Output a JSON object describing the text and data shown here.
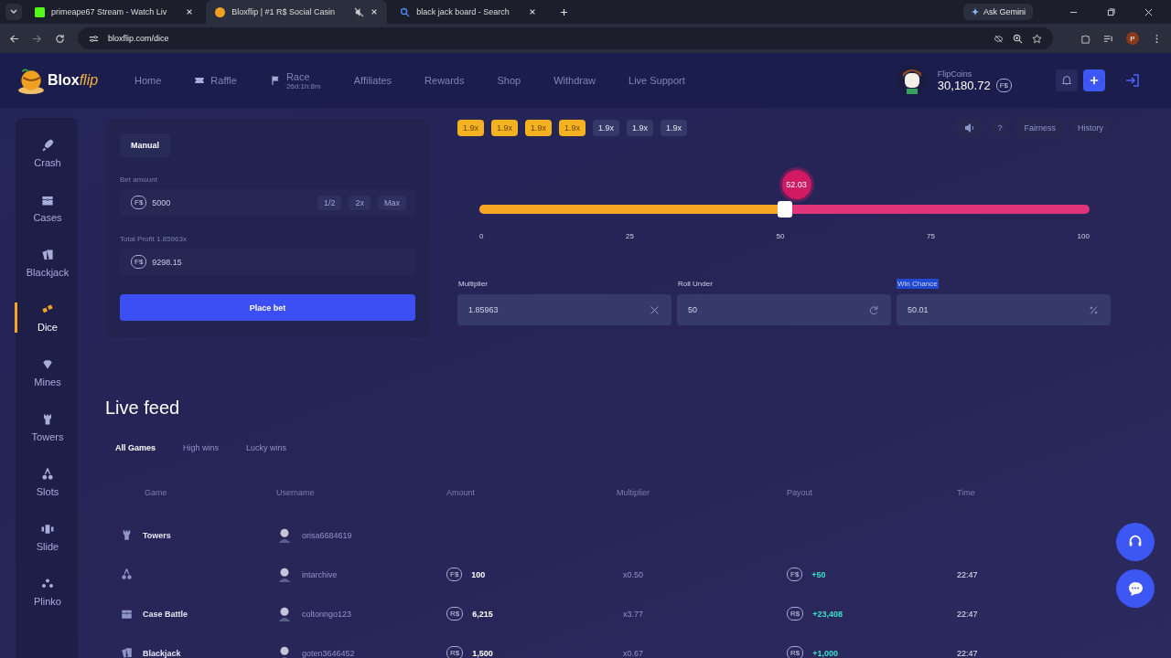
{
  "browser": {
    "tabs": [
      {
        "title": "primeape67 Stream - Watch Liv",
        "kind": "kick",
        "selected": false
      },
      {
        "title": "Bloxflip | #1 R$ Social Casin",
        "kind": "coin",
        "selected": true,
        "muted": true
      },
      {
        "title": "black jack board - Search",
        "kind": "search",
        "selected": false
      }
    ],
    "url": "bloxflip.com/dice",
    "gemini": "Ask Gemini",
    "profile": "P"
  },
  "header": {
    "logo": "Blox",
    "logo_accent": "flip",
    "nav": [
      {
        "label": "Home",
        "kind": "text"
      },
      {
        "label": "Raffle",
        "kind": "raffle"
      },
      {
        "label": "Race",
        "kind": "race",
        "sub": "26d:1h:8m"
      },
      {
        "label": "Affiliates",
        "kind": "text"
      },
      {
        "label": "Rewards",
        "kind": "text"
      },
      {
        "label": "Shop",
        "kind": "text"
      },
      {
        "label": "Withdraw",
        "kind": "text"
      },
      {
        "label": "Live Support",
        "kind": "text"
      }
    ],
    "balance": {
      "label": "FlipCoins",
      "amount": "30,180.72",
      "currency": "F$"
    }
  },
  "sidebar": {
    "items": [
      {
        "label": "Crash",
        "kind": "crash",
        "selected": false
      },
      {
        "label": "Cases",
        "kind": "cases",
        "selected": false
      },
      {
        "label": "Blackjack",
        "kind": "blackjack",
        "selected": false
      },
      {
        "label": "Dice",
        "kind": "dice",
        "selected": true
      },
      {
        "label": "Mines",
        "kind": "mines",
        "selected": false
      },
      {
        "label": "Towers",
        "kind": "towers",
        "selected": false
      },
      {
        "label": "Slots",
        "kind": "slots",
        "selected": false
      },
      {
        "label": "Slide",
        "kind": "slide",
        "selected": false
      },
      {
        "label": "Plinko",
        "kind": "plinko",
        "selected": false
      }
    ]
  },
  "bet_panel": {
    "mode": "Manual",
    "bet_label": "Bet amount",
    "bet_currency": "F$",
    "bet_value": "5000",
    "bet_buttons": [
      "1/2",
      "2x",
      "Max"
    ],
    "profit_label": "Total Profit 1.85963x",
    "profit_currency": "F$",
    "profit_value": "9298.15",
    "place_bet": "Place bet"
  },
  "game": {
    "history": [
      {
        "label": "1.9x",
        "win": true
      },
      {
        "label": "1.9x",
        "win": true
      },
      {
        "label": "1.9x",
        "win": true
      },
      {
        "label": "1.9x",
        "win": true
      },
      {
        "label": "1.9x",
        "win": false
      },
      {
        "label": "1.9x",
        "win": false
      },
      {
        "label": "1.9x",
        "win": false
      }
    ],
    "help": "?",
    "fairness": "Fairness",
    "history_button": "History",
    "slider": {
      "level": 0.5,
      "result": "52.03",
      "ticks": [
        "0",
        "25",
        "50",
        "75",
        "100"
      ]
    },
    "fields": [
      {
        "label": "Multiplier",
        "value": "1.85963",
        "kind": "clear",
        "highlighted": false
      },
      {
        "label": "Roll Under",
        "value": "50",
        "kind": "swap",
        "highlighted": false
      },
      {
        "label": "Win Chance",
        "value": "50.01",
        "kind": "percent",
        "highlighted": true
      }
    ]
  },
  "live_feed": {
    "title": "Live feed",
    "tabs": [
      {
        "label": "All Games",
        "selected": true
      },
      {
        "label": "High wins",
        "selected": false
      },
      {
        "label": "Lucky wins",
        "selected": false
      }
    ],
    "columns": [
      "Game",
      "Username",
      "Amount",
      "Multiplier",
      "Payout",
      "Time"
    ],
    "rows": [
      {
        "kind": "towers",
        "game": "Towers",
        "user": "orisa6684619"
      },
      {
        "kind": "slots",
        "user": "intarchive",
        "amount_currency": "F$",
        "amount": "100",
        "multiplier": "x0.50",
        "payout_currency": "F$",
        "payout": "+50",
        "time": "22:47"
      },
      {
        "kind": "cases",
        "game": "Case Battle",
        "user": "coltonngo123",
        "amount_currency": "R$",
        "amount": "6,215",
        "multiplier": "x3.77",
        "payout_currency": "R$",
        "payout": "+23,408",
        "time": "22:47"
      },
      {
        "kind": "blackjack",
        "game": "Blackjack",
        "user": "goten3646452",
        "amount_currency": "R$",
        "amount": "1,500",
        "multiplier": "x0.67",
        "payout_currency": "R$",
        "payout": "+1,000",
        "time": "22:47"
      }
    ]
  }
}
